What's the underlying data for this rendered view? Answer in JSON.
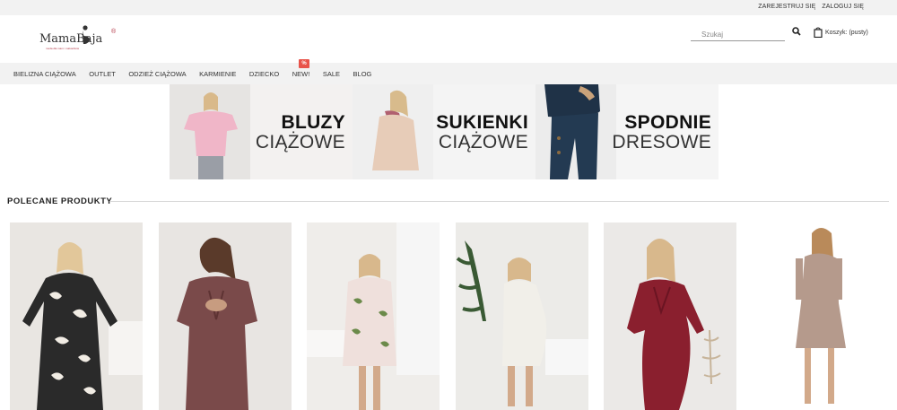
{
  "topbar": {
    "register": "ZAREJESTRUJ SIĘ",
    "login": "ZALOGUJ SIĘ"
  },
  "logo": {
    "text": "MamaBaja",
    "registered": "®",
    "tagline": "moda dla mam i maluszków",
    "brand_color": "#b03040"
  },
  "search": {
    "placeholder": "Szukaj",
    "icon": "search-icon"
  },
  "cart": {
    "label": "Koszyk: (pusty)",
    "icon": "shopping-bag-icon"
  },
  "nav": {
    "items": [
      {
        "label": "BIELIZNA CIĄŻOWA"
      },
      {
        "label": "OUTLET"
      },
      {
        "label": "ODZIEŻ CIĄŻOWA"
      },
      {
        "label": "KARMIENIE"
      },
      {
        "label": "DZIECKO"
      },
      {
        "label": "NEW!"
      },
      {
        "label": "SALE"
      },
      {
        "label": "BLOG"
      }
    ],
    "sale_badge": "%",
    "sale_badge_color": "#e8534a"
  },
  "banners": [
    {
      "line1": "BLUZY",
      "line2": "CIĄŻOWE"
    },
    {
      "line1": "SUKIENKI",
      "line2": "CIĄŻOWE"
    },
    {
      "line1": "SPODNIE",
      "line2": "DRESOWE"
    }
  ],
  "section": {
    "title": "POLECANE PRODUKTY"
  },
  "products": [
    {
      "dress_color": "#2a2a2a",
      "bg": "#e9e6e2"
    },
    {
      "dress_color": "#7a4a4a",
      "bg": "#e8e5e2"
    },
    {
      "dress_color": "#efe0dc",
      "bg": "#efedea"
    },
    {
      "dress_color": "#f1efe9",
      "bg": "#ecebe8"
    },
    {
      "dress_color": "#8a1f2e",
      "bg": "#ebe9e7"
    },
    {
      "dress_color": "#b59a8c",
      "bg": "#ffffff"
    }
  ]
}
